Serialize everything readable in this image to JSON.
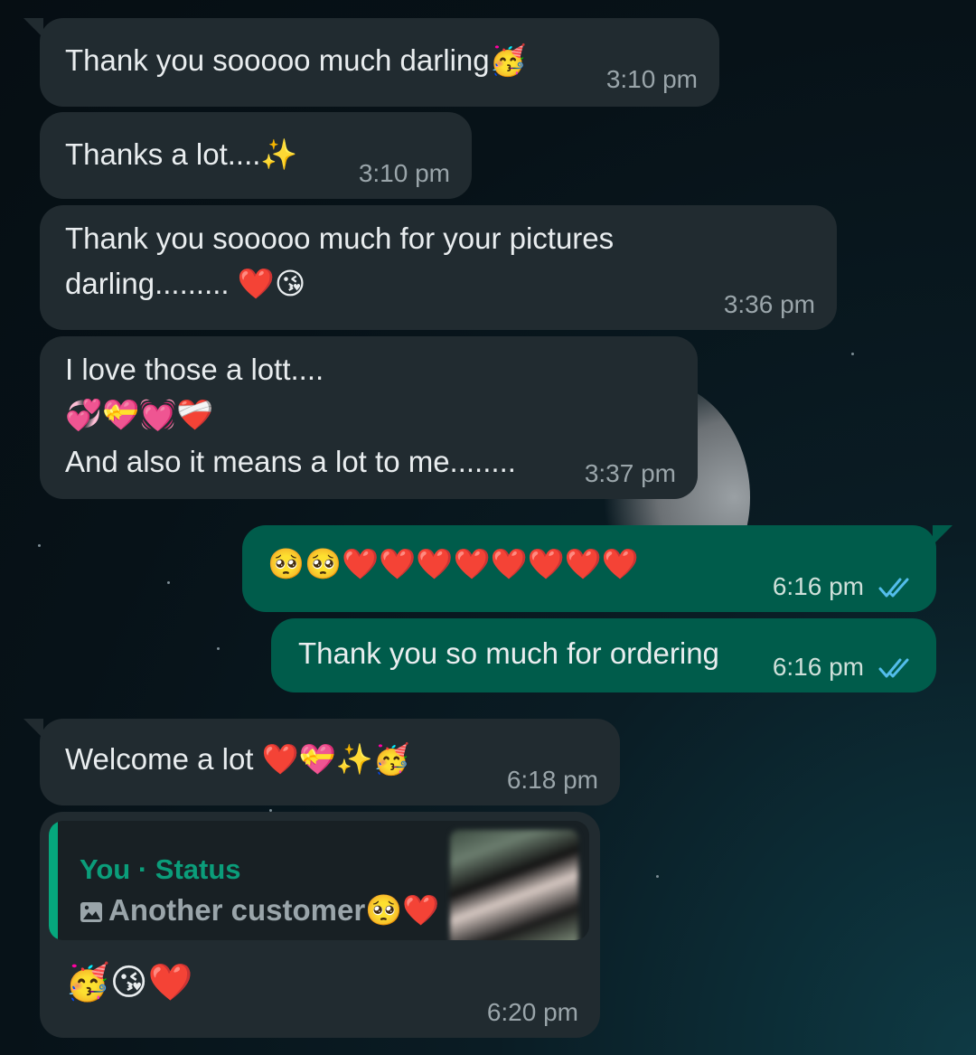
{
  "messages": [
    {
      "id": "m1",
      "dir": "in",
      "text": "Thank you sooooo much darling🥳",
      "time": "3:10 pm"
    },
    {
      "id": "m2",
      "dir": "in",
      "text": "Thanks a lot....✨",
      "time": "3:10 pm"
    },
    {
      "id": "m3",
      "dir": "in",
      "line1": "Thank you sooooo much for your pictures",
      "line2": "darling......... ❤️😘",
      "time": "3:36 pm"
    },
    {
      "id": "m4",
      "dir": "in",
      "line1": "I love those a lott....",
      "line2": "💞💝💓❤️‍🩹",
      "line3": "And also it means a lot to me........",
      "time": "3:37 pm"
    },
    {
      "id": "m5",
      "dir": "out",
      "text": "🥺🥺❤️❤️❤️❤️❤️❤️❤️❤️",
      "time": "6:16 pm",
      "status": "read"
    },
    {
      "id": "m6",
      "dir": "out",
      "text": "Thank you so much for ordering",
      "time": "6:16 pm",
      "status": "read"
    },
    {
      "id": "m7",
      "dir": "in",
      "text": "Welcome a lot ❤️💝✨🥳",
      "time": "6:18 pm"
    },
    {
      "id": "m8",
      "dir": "in",
      "quote": {
        "author": "You · Status",
        "text": "Another customer🥺❤️",
        "icon": "image-icon"
      },
      "text": "🥳😘❤️",
      "time": "6:20 pm"
    }
  ],
  "colors": {
    "incoming": "#212b30",
    "outgoing": "#005c4b",
    "tick": "#53bdeb",
    "quote_accent": "#06a77d"
  }
}
